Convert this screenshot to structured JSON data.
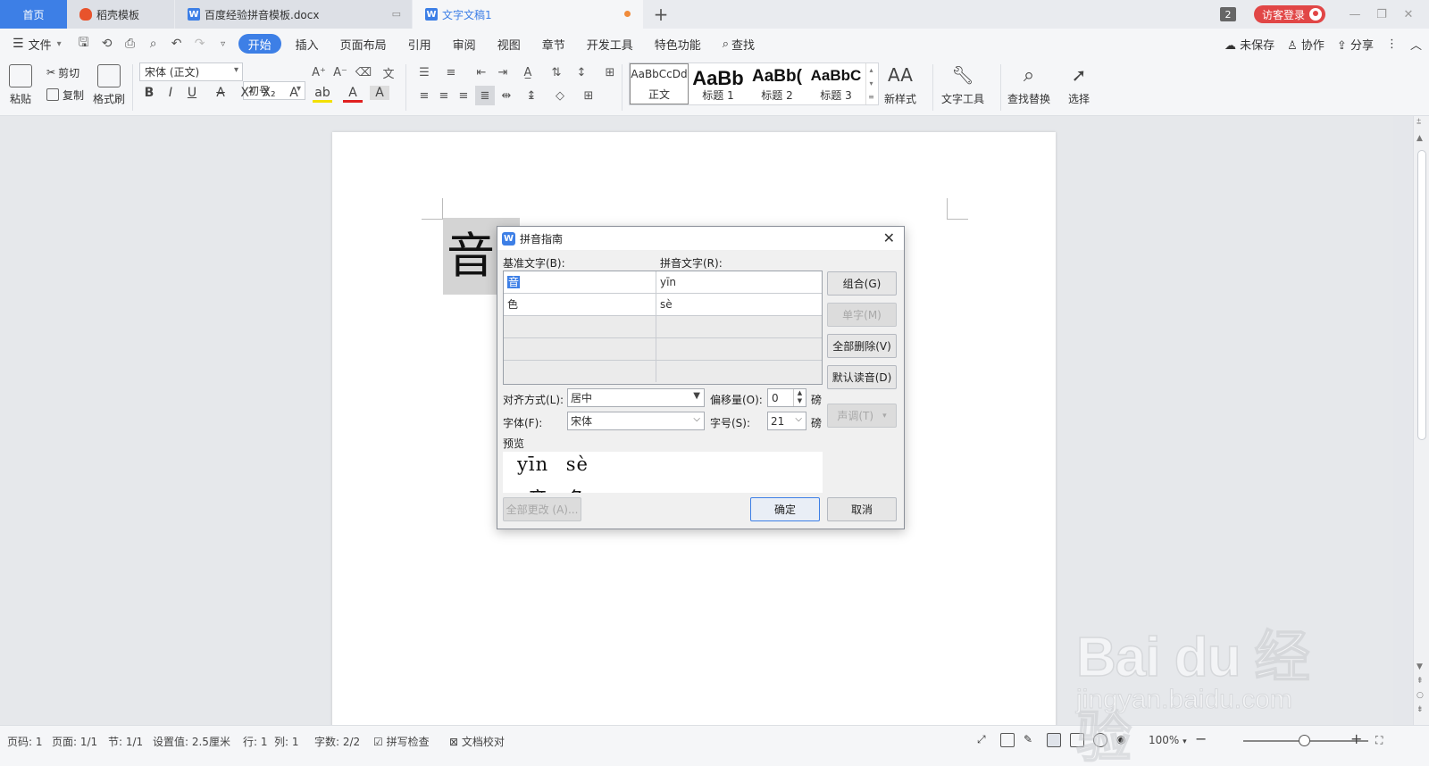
{
  "tabs": {
    "home": "首页",
    "tab1": "稻壳模板",
    "tab2": "百度经验拼音模板.docx",
    "tab3": "文字文稿1",
    "notification_count": "2",
    "login": "访客登录"
  },
  "menu": {
    "file": "文件",
    "items": [
      "开始",
      "插入",
      "页面布局",
      "引用",
      "审阅",
      "视图",
      "章节",
      "开发工具",
      "特色功能"
    ],
    "search": "查找",
    "unsaved": "未保存",
    "collaborate": "协作",
    "share": "分享"
  },
  "ribbon": {
    "paste": "粘贴",
    "cut": "剪切",
    "copy": "复制",
    "format_painter": "格式刷",
    "font_name": "宋体 (正文)",
    "font_size": "初号",
    "styles": [
      {
        "sample": "AaBbCcDd",
        "label": "正文"
      },
      {
        "sample": "AaBb",
        "label": "标题 1"
      },
      {
        "sample": "AaBb(",
        "label": "标题 2"
      },
      {
        "sample": "AaBbC",
        "label": "标题 3"
      }
    ],
    "new_style": "新样式",
    "text_tools": "文字工具",
    "find_replace": "查找替换",
    "select": "选择"
  },
  "document": {
    "visible_char": "音"
  },
  "dialog": {
    "title": "拼音指南",
    "base_text_label": "基准文字(B):",
    "ruby_text_label": "拼音文字(R):",
    "rows": [
      {
        "base": "音",
        "ruby": "yīn"
      },
      {
        "base": "色",
        "ruby": "sè"
      }
    ],
    "btn_group": "组合(G)",
    "btn_single": "单字(M)",
    "btn_clear_all": "全部删除(V)",
    "btn_default": "默认读音(D)",
    "btn_tone": "声调(T)",
    "align_label": "对齐方式(L):",
    "align_value": "居中",
    "offset_label": "偏移量(O):",
    "offset_value": "0",
    "unit1": "磅",
    "font_label": "字体(F):",
    "font_value": "宋体",
    "size_label": "字号(S):",
    "size_value": "21",
    "unit2": "磅",
    "preview_label": "预览",
    "preview_pinyin": "yīn sè",
    "btn_change_all": "全部更改 (A)...",
    "btn_ok": "确定",
    "btn_cancel": "取消"
  },
  "status": {
    "page": "页码: 1",
    "pages": "页面: 1/1",
    "section": "节: 1/1",
    "setting": "设置值: 2.5厘米",
    "line": "行: 1",
    "col": "列: 1",
    "words": "字数: 2/2",
    "spell": "拼写检查",
    "proof": "文档校对",
    "zoom": "100%"
  },
  "watermark": {
    "brand": "Bai du 经验",
    "url": "jingyan.baidu.com"
  }
}
